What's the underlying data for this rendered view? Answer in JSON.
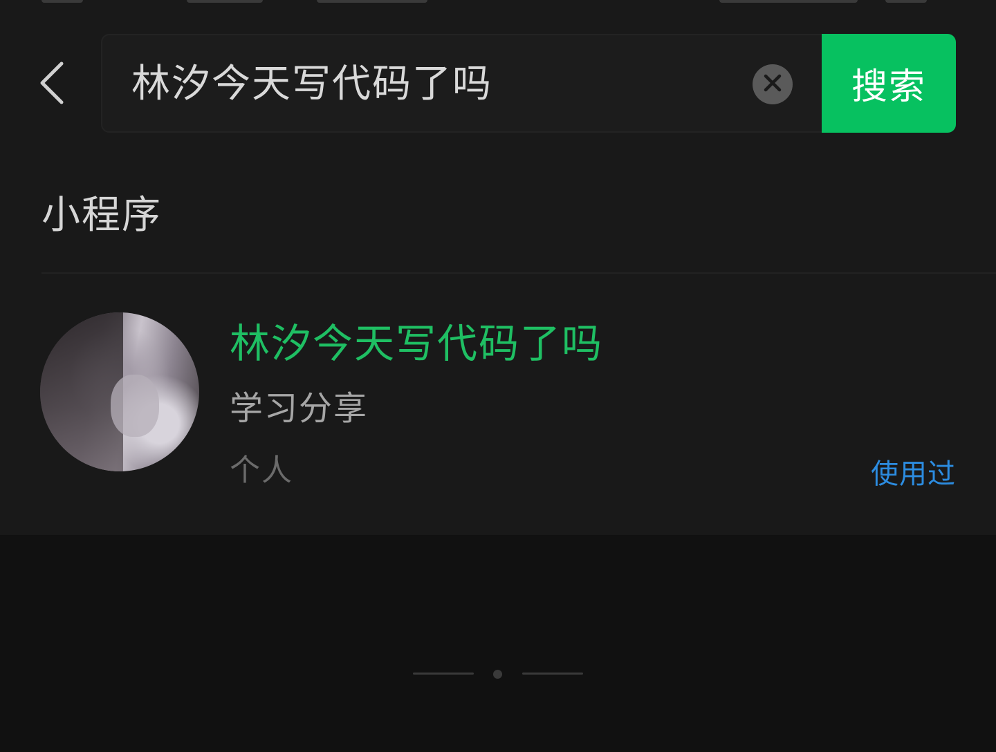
{
  "search": {
    "value": "林汐今天写代码了吗",
    "button_label": "搜索"
  },
  "section": {
    "title": "小程序"
  },
  "result": {
    "title": "林汐今天写代码了吗",
    "description": "学习分享",
    "type": "个人",
    "tag": "使用过"
  },
  "colors": {
    "accent": "#07c160",
    "highlight_text": "#1fbf63",
    "link": "#2c8ce0",
    "background": "#111111",
    "surface": "#191919"
  },
  "icons": {
    "back": "chevron-left-icon",
    "clear": "clear-icon"
  }
}
